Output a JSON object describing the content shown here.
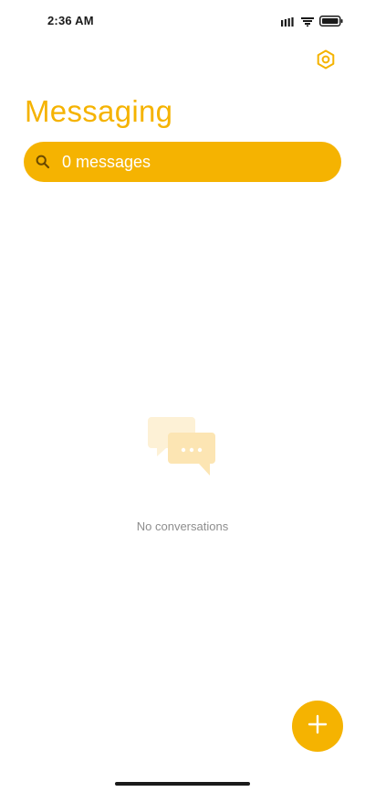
{
  "status_bar": {
    "time": "2:36 AM",
    "signal_icon": "signal-bars-icon",
    "wifi_icon": "wifi-icon",
    "battery_icon": "battery-icon"
  },
  "header": {
    "title": "Messaging",
    "settings_icon": "settings-icon"
  },
  "search": {
    "label": "0 messages",
    "icon": "search-icon"
  },
  "empty_state": {
    "icon": "chat-bubbles-icon",
    "text": "No conversations"
  },
  "fab": {
    "icon": "plus-icon"
  },
  "colors": {
    "accent": "#f5b301",
    "title": "#f5b301",
    "muted_text": "#8e8e8e",
    "background": "#ffffff"
  }
}
